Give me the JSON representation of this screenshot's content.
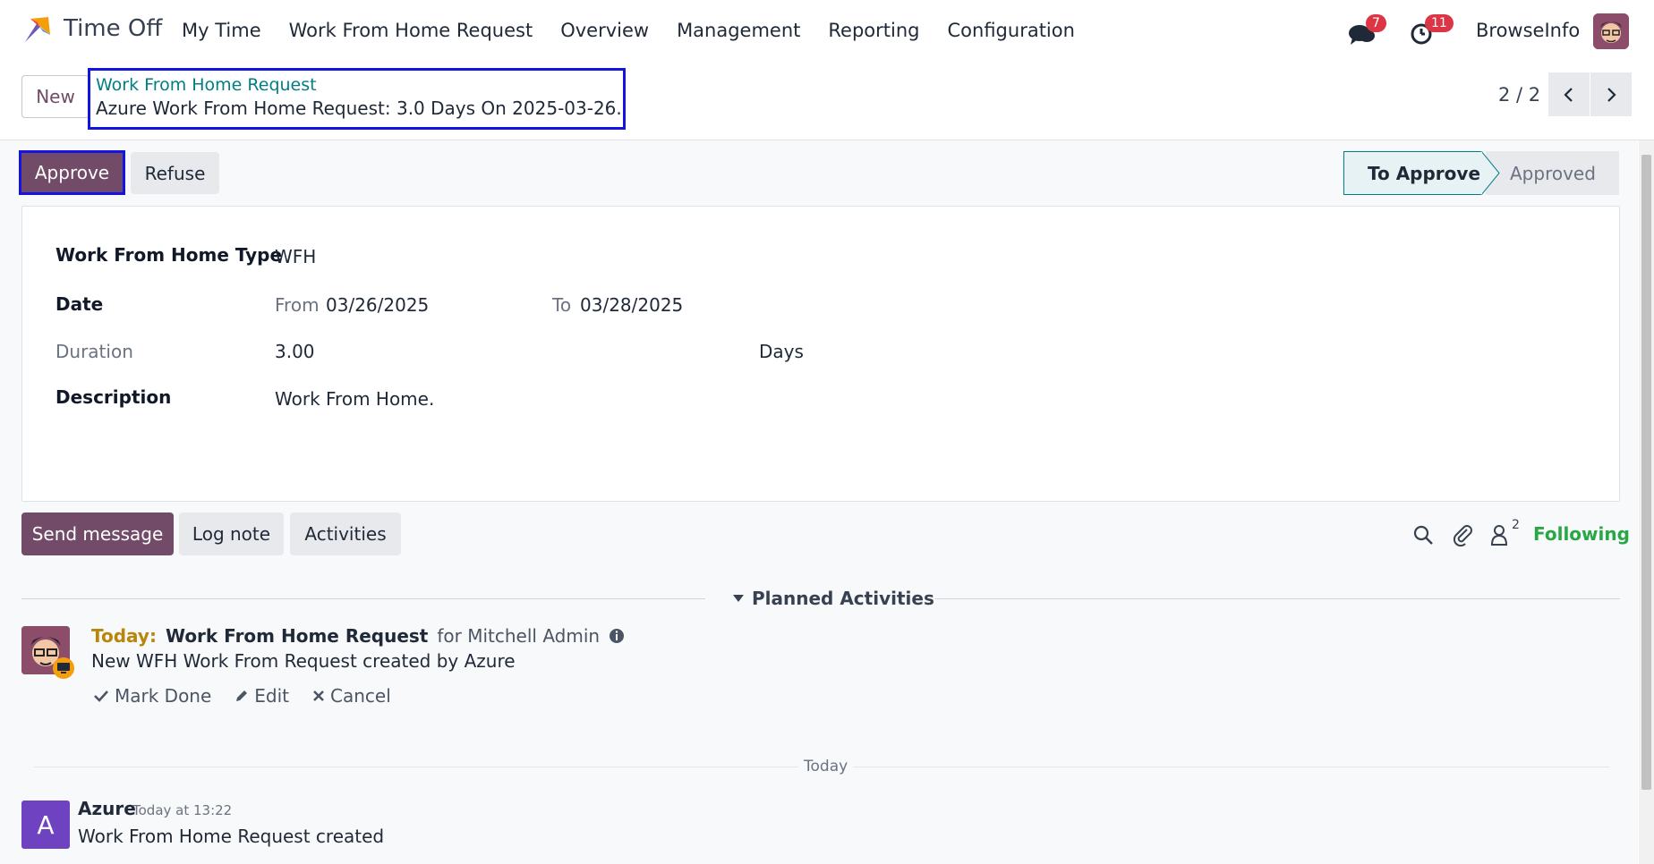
{
  "navbar": {
    "app_name": "Time Off",
    "menu": [
      "My Time",
      "Work From Home Request",
      "Overview",
      "Management",
      "Reporting",
      "Configuration"
    ],
    "messages_badge": "7",
    "activities_badge": "11",
    "company": "BrowseInfo"
  },
  "control": {
    "new_label": "New",
    "breadcrumb_parent": "Work From Home Request",
    "breadcrumb_current": "Azure Work From Home Request: 3.0 Days On 2025-03-26.",
    "pager": "2 / 2"
  },
  "statusbar": {
    "approve": "Approve",
    "refuse": "Refuse",
    "stages": [
      "To Approve",
      "Approved"
    ],
    "active_stage": "To Approve"
  },
  "form": {
    "type_label": "Work From Home Type",
    "type_value": "WFH",
    "date_label": "Date",
    "from_label": "From",
    "from_value": "03/26/2025",
    "to_label": "To",
    "to_value": "03/28/2025",
    "duration_label": "Duration",
    "duration_value": "3.00",
    "duration_unit": "Days",
    "description_label": "Description",
    "description_value": "Work From Home."
  },
  "chatter": {
    "send_message": "Send message",
    "log_note": "Log note",
    "activities": "Activities",
    "followers_count": "2",
    "following": "Following",
    "planned_title": "Planned Activities",
    "activity": {
      "due": "Today:",
      "title": "Work From Home Request",
      "assignee": "for Mitchell Admin",
      "note": "New WFH Work From Request created by Azure",
      "mark_done": "Mark Done",
      "edit": "Edit",
      "cancel": "Cancel"
    },
    "date_separator": "Today",
    "message": {
      "avatar_letter": "A",
      "author": "Azure",
      "time": "Today at 13:22",
      "body": "Work From Home Request created"
    }
  },
  "colors": {
    "brand": "#714b67",
    "teal": "#017e84",
    "following": "#28a745",
    "highlight_border": "#1414e0"
  }
}
